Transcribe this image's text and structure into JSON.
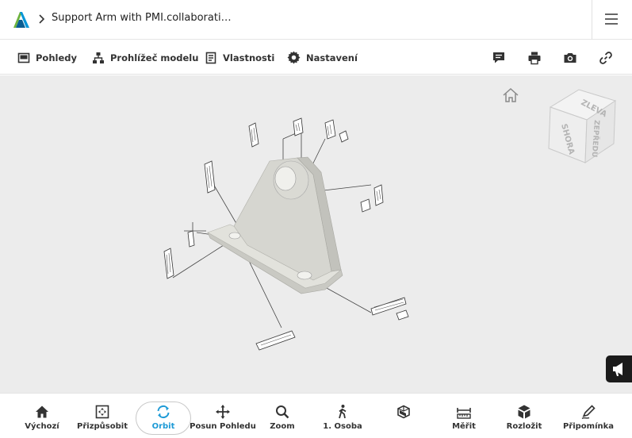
{
  "header": {
    "title": "Support Arm with PMI.collaborati…",
    "brand_color": "#0696d7"
  },
  "toolbar": {
    "items": [
      {
        "label": "Pohledy",
        "icon": "views-icon"
      },
      {
        "label": "Prohlížeč modelu",
        "icon": "model-browser-icon"
      },
      {
        "label": "Vlastnosti",
        "icon": "properties-icon"
      },
      {
        "label": "Nastavení",
        "icon": "gear-icon"
      }
    ],
    "right_icons": [
      "comment-icon",
      "print-icon",
      "camera-icon",
      "link-icon"
    ]
  },
  "viewcube": {
    "faces": [
      "ZLEVA",
      "SHORA",
      "ZEPŘEDU"
    ]
  },
  "bottom": {
    "active_color": "#1d9ad6",
    "items": [
      {
        "label": "Výchozí",
        "icon": "home-icon"
      },
      {
        "label": "Přizpůsobit",
        "icon": "fit-icon"
      },
      {
        "label": "Orbit",
        "icon": "orbit-icon",
        "active": true
      },
      {
        "label": "Posun Pohledu",
        "icon": "pan-icon"
      },
      {
        "label": "Zoom",
        "icon": "zoom-icon"
      },
      {
        "label": "1. Osoba",
        "icon": "first-person-icon"
      },
      {
        "label": "",
        "icon": "section-icon"
      },
      {
        "label": "Měřit",
        "icon": "measure-icon"
      },
      {
        "label": "Rozložit",
        "icon": "explode-icon"
      },
      {
        "label": "Připomínka",
        "icon": "markup-icon"
      }
    ]
  }
}
